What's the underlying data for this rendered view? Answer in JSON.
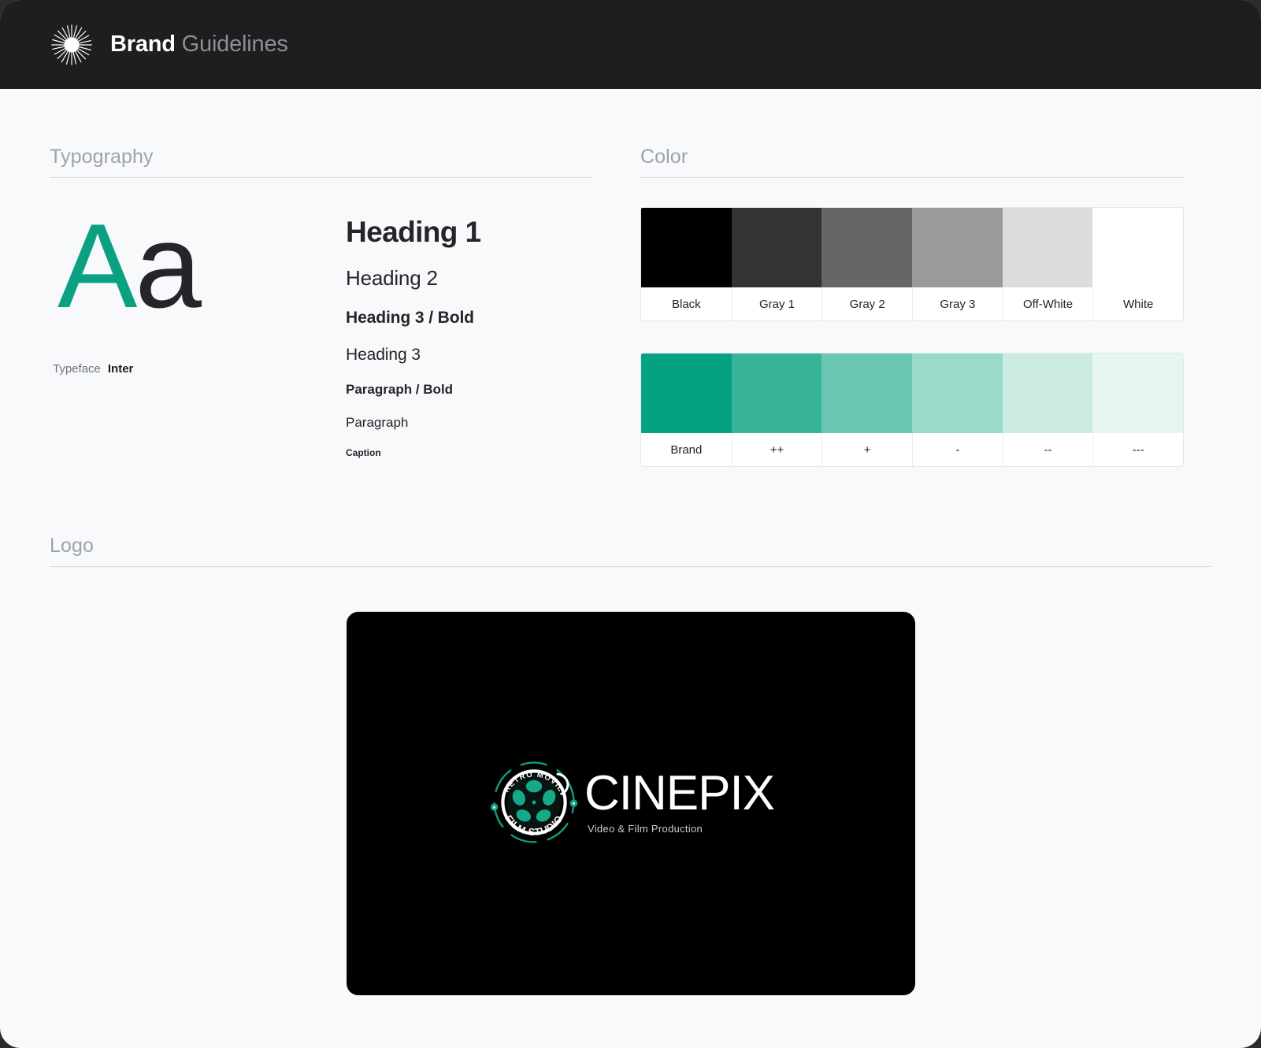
{
  "header": {
    "logo_icon": "starburst-icon",
    "title_bold": "Brand",
    "title_light": "Guidelines"
  },
  "typography": {
    "section_title": "Typography",
    "specimen_upper": "A",
    "specimen_lower": "a",
    "typeface_label": "Typeface",
    "typeface_value": "Inter",
    "scale": [
      "Heading 1",
      "Heading 2",
      "Heading 3 / Bold",
      "Heading 3",
      "Paragraph / Bold",
      "Paragraph",
      "Caption"
    ]
  },
  "color": {
    "section_title": "Color",
    "neutral_row": [
      {
        "label": "Black",
        "hex": "#000000"
      },
      {
        "label": "Gray 1",
        "hex": "#333336"
      },
      {
        "label": "Gray 2",
        "hex": "#666668"
      },
      {
        "label": "Gray 3",
        "hex": "#9a9a9c"
      },
      {
        "label": "Off-White",
        "hex": "#dcdcdc"
      },
      {
        "label": "White",
        "hex": "#ffffff"
      }
    ],
    "brand_row": [
      {
        "label": "Brand",
        "hex": "#06a180"
      },
      {
        "label": "++",
        "hex": "#38b49a"
      },
      {
        "label": "+",
        "hex": "#6bc7b1"
      },
      {
        "label": "-",
        "hex": "#9bd9c9"
      },
      {
        "label": "--",
        "hex": "#cbeae1"
      },
      {
        "label": "---",
        "hex": "#e6f5f0"
      }
    ]
  },
  "logo": {
    "section_title": "Logo",
    "emblem_top_text": "RETRO MOVIE",
    "emblem_bottom_text": "FILM STUDIO",
    "wordmark": "CINEPIX",
    "tagline": "Video & Film Production",
    "card_background": "#000000",
    "emblem_accent": "#0f9e82"
  }
}
